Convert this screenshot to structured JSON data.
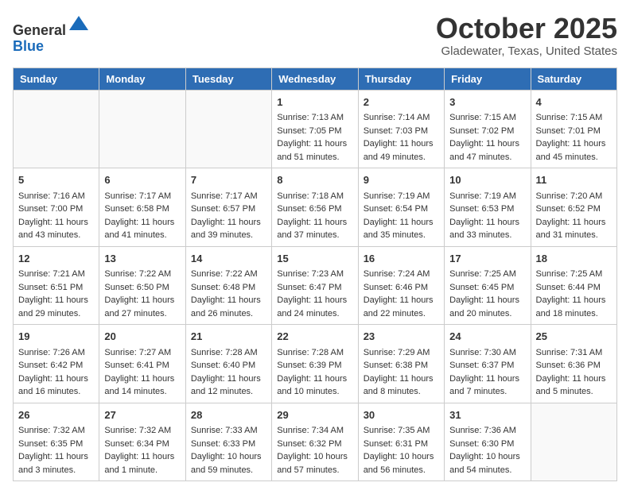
{
  "header": {
    "logo_line1": "General",
    "logo_line2": "Blue",
    "month": "October 2025",
    "location": "Gladewater, Texas, United States"
  },
  "days_of_week": [
    "Sunday",
    "Monday",
    "Tuesday",
    "Wednesday",
    "Thursday",
    "Friday",
    "Saturday"
  ],
  "weeks": [
    [
      {
        "day": "",
        "info": ""
      },
      {
        "day": "",
        "info": ""
      },
      {
        "day": "",
        "info": ""
      },
      {
        "day": "1",
        "info": "Sunrise: 7:13 AM\nSunset: 7:05 PM\nDaylight: 11 hours and 51 minutes."
      },
      {
        "day": "2",
        "info": "Sunrise: 7:14 AM\nSunset: 7:03 PM\nDaylight: 11 hours and 49 minutes."
      },
      {
        "day": "3",
        "info": "Sunrise: 7:15 AM\nSunset: 7:02 PM\nDaylight: 11 hours and 47 minutes."
      },
      {
        "day": "4",
        "info": "Sunrise: 7:15 AM\nSunset: 7:01 PM\nDaylight: 11 hours and 45 minutes."
      }
    ],
    [
      {
        "day": "5",
        "info": "Sunrise: 7:16 AM\nSunset: 7:00 PM\nDaylight: 11 hours and 43 minutes."
      },
      {
        "day": "6",
        "info": "Sunrise: 7:17 AM\nSunset: 6:58 PM\nDaylight: 11 hours and 41 minutes."
      },
      {
        "day": "7",
        "info": "Sunrise: 7:17 AM\nSunset: 6:57 PM\nDaylight: 11 hours and 39 minutes."
      },
      {
        "day": "8",
        "info": "Sunrise: 7:18 AM\nSunset: 6:56 PM\nDaylight: 11 hours and 37 minutes."
      },
      {
        "day": "9",
        "info": "Sunrise: 7:19 AM\nSunset: 6:54 PM\nDaylight: 11 hours and 35 minutes."
      },
      {
        "day": "10",
        "info": "Sunrise: 7:19 AM\nSunset: 6:53 PM\nDaylight: 11 hours and 33 minutes."
      },
      {
        "day": "11",
        "info": "Sunrise: 7:20 AM\nSunset: 6:52 PM\nDaylight: 11 hours and 31 minutes."
      }
    ],
    [
      {
        "day": "12",
        "info": "Sunrise: 7:21 AM\nSunset: 6:51 PM\nDaylight: 11 hours and 29 minutes."
      },
      {
        "day": "13",
        "info": "Sunrise: 7:22 AM\nSunset: 6:50 PM\nDaylight: 11 hours and 27 minutes."
      },
      {
        "day": "14",
        "info": "Sunrise: 7:22 AM\nSunset: 6:48 PM\nDaylight: 11 hours and 26 minutes."
      },
      {
        "day": "15",
        "info": "Sunrise: 7:23 AM\nSunset: 6:47 PM\nDaylight: 11 hours and 24 minutes."
      },
      {
        "day": "16",
        "info": "Sunrise: 7:24 AM\nSunset: 6:46 PM\nDaylight: 11 hours and 22 minutes."
      },
      {
        "day": "17",
        "info": "Sunrise: 7:25 AM\nSunset: 6:45 PM\nDaylight: 11 hours and 20 minutes."
      },
      {
        "day": "18",
        "info": "Sunrise: 7:25 AM\nSunset: 6:44 PM\nDaylight: 11 hours and 18 minutes."
      }
    ],
    [
      {
        "day": "19",
        "info": "Sunrise: 7:26 AM\nSunset: 6:42 PM\nDaylight: 11 hours and 16 minutes."
      },
      {
        "day": "20",
        "info": "Sunrise: 7:27 AM\nSunset: 6:41 PM\nDaylight: 11 hours and 14 minutes."
      },
      {
        "day": "21",
        "info": "Sunrise: 7:28 AM\nSunset: 6:40 PM\nDaylight: 11 hours and 12 minutes."
      },
      {
        "day": "22",
        "info": "Sunrise: 7:28 AM\nSunset: 6:39 PM\nDaylight: 11 hours and 10 minutes."
      },
      {
        "day": "23",
        "info": "Sunrise: 7:29 AM\nSunset: 6:38 PM\nDaylight: 11 hours and 8 minutes."
      },
      {
        "day": "24",
        "info": "Sunrise: 7:30 AM\nSunset: 6:37 PM\nDaylight: 11 hours and 7 minutes."
      },
      {
        "day": "25",
        "info": "Sunrise: 7:31 AM\nSunset: 6:36 PM\nDaylight: 11 hours and 5 minutes."
      }
    ],
    [
      {
        "day": "26",
        "info": "Sunrise: 7:32 AM\nSunset: 6:35 PM\nDaylight: 11 hours and 3 minutes."
      },
      {
        "day": "27",
        "info": "Sunrise: 7:32 AM\nSunset: 6:34 PM\nDaylight: 11 hours and 1 minute."
      },
      {
        "day": "28",
        "info": "Sunrise: 7:33 AM\nSunset: 6:33 PM\nDaylight: 10 hours and 59 minutes."
      },
      {
        "day": "29",
        "info": "Sunrise: 7:34 AM\nSunset: 6:32 PM\nDaylight: 10 hours and 57 minutes."
      },
      {
        "day": "30",
        "info": "Sunrise: 7:35 AM\nSunset: 6:31 PM\nDaylight: 10 hours and 56 minutes."
      },
      {
        "day": "31",
        "info": "Sunrise: 7:36 AM\nSunset: 6:30 PM\nDaylight: 10 hours and 54 minutes."
      },
      {
        "day": "",
        "info": ""
      }
    ]
  ]
}
